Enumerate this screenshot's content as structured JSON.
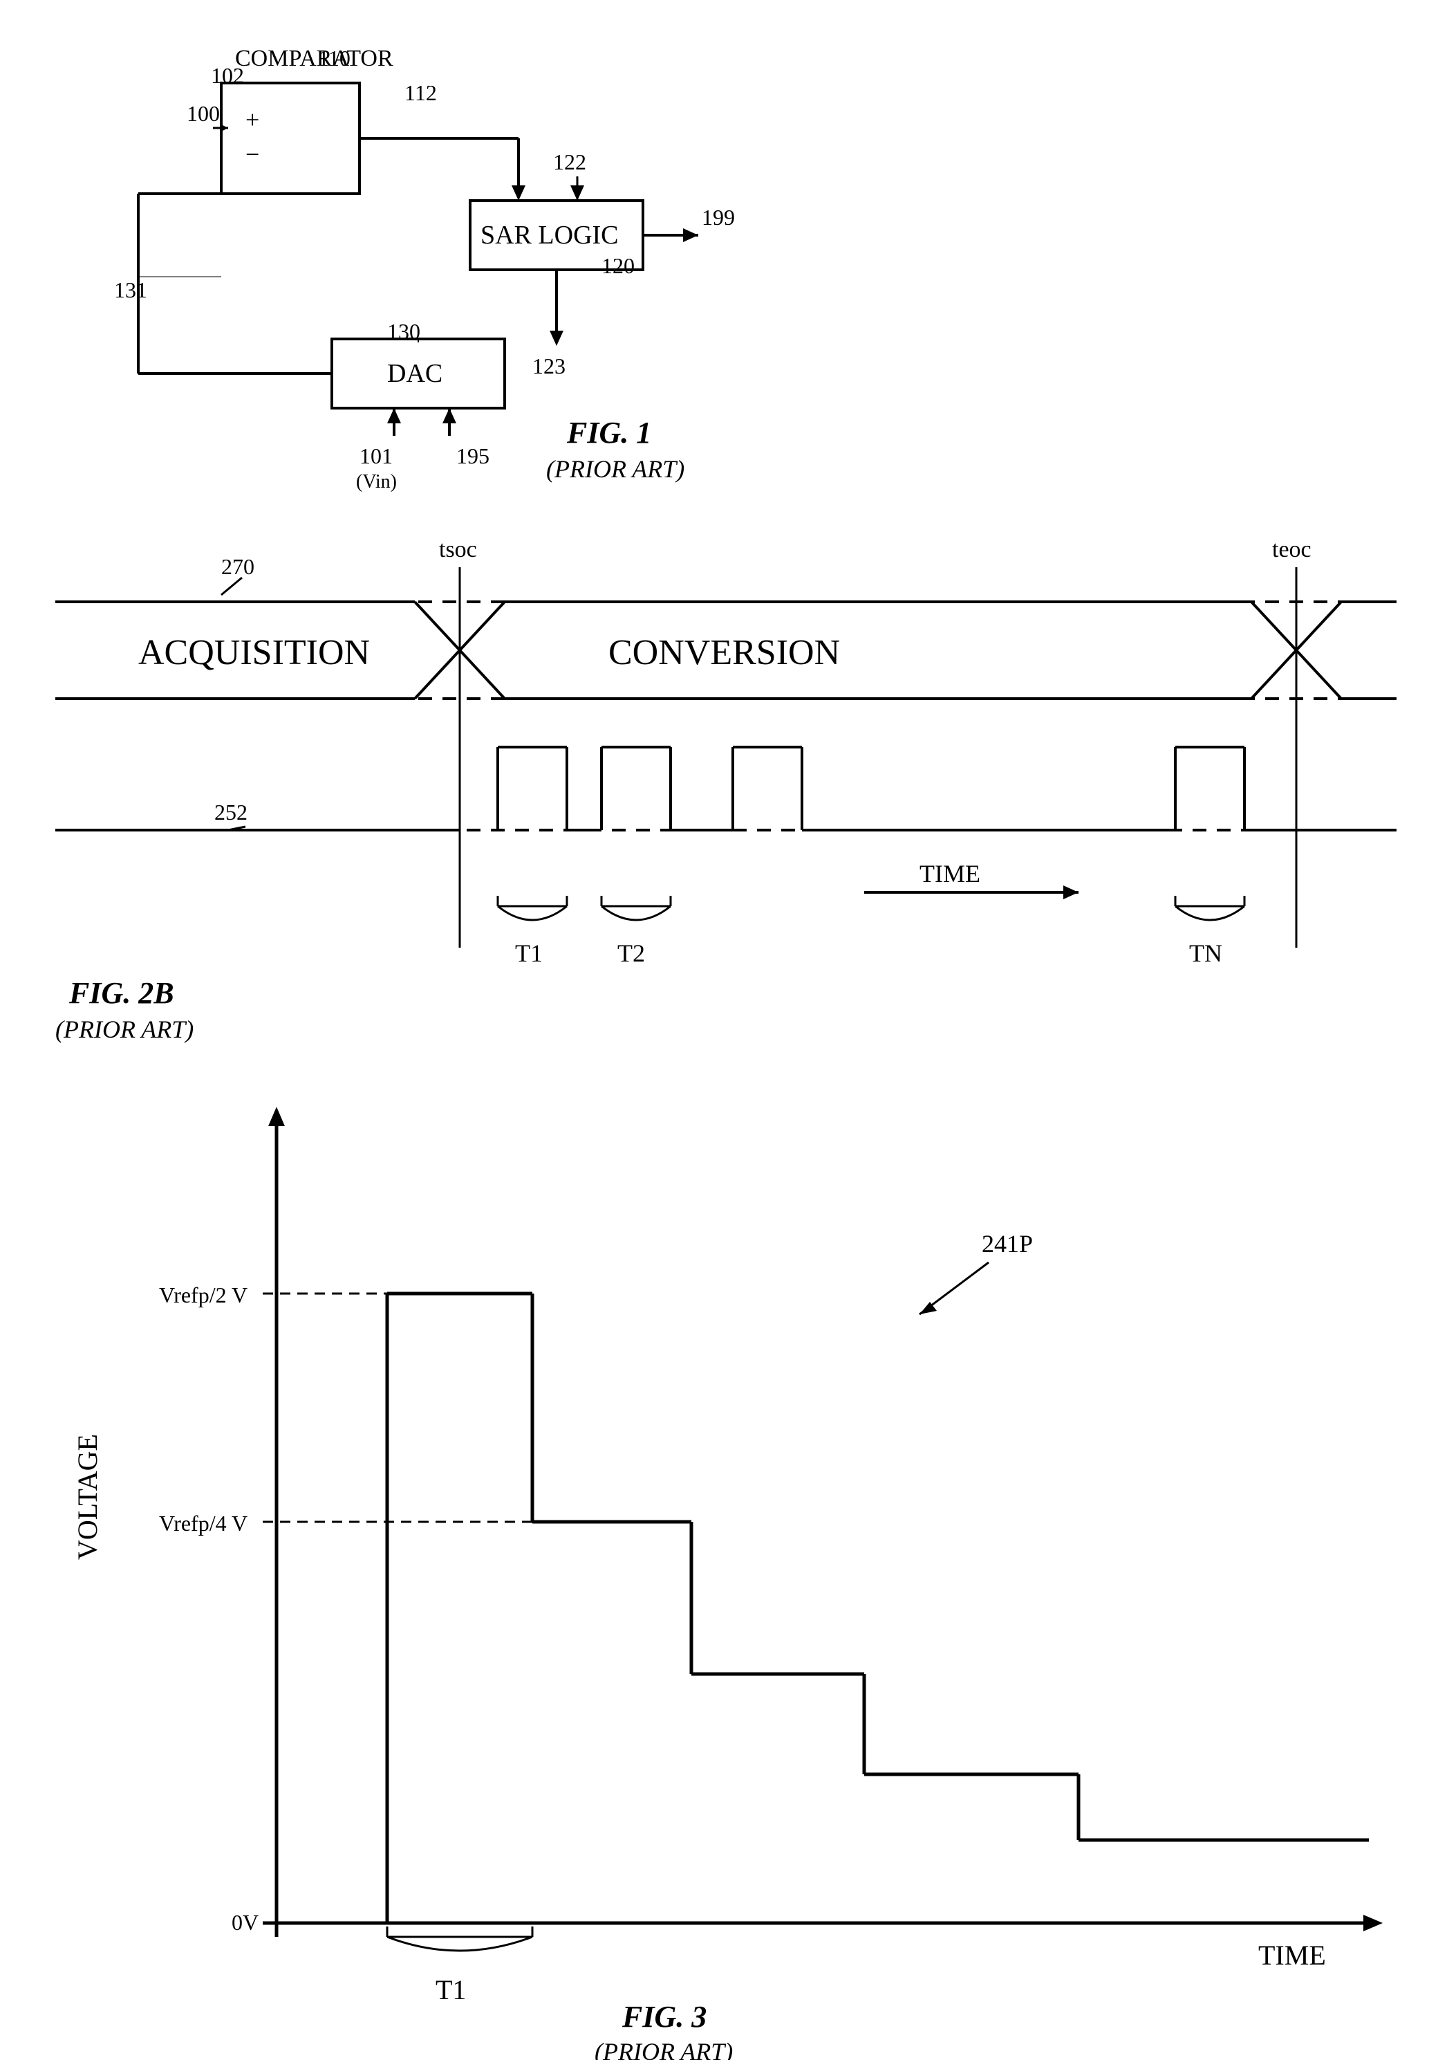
{
  "fig1": {
    "title": "FIG. 1",
    "subtitle": "(PRIOR ART)",
    "labels": {
      "comparator": "COMPARATOR",
      "sar_logic": "SAR LOGIC",
      "dac": "DAC",
      "n100": "100",
      "n101": "101",
      "n102": "102",
      "n110": "110",
      "n112": "112",
      "n120": "120",
      "n122": "122",
      "n123": "123",
      "n130": "130",
      "n131": "131",
      "n195": "195",
      "n199": "199",
      "vin": "(Vin)"
    }
  },
  "fig2b": {
    "title": "FIG. 2B",
    "subtitle": "(PRIOR ART)",
    "labels": {
      "acquisition": "ACQUISITION",
      "conversion": "CONVERSION",
      "n270": "270",
      "n252": "252",
      "tsoc": "tsoc",
      "teoc": "teoc",
      "t1": "T1",
      "t2": "T2",
      "tn": "TN",
      "time": "TIME"
    }
  },
  "fig3": {
    "title": "FIG. 3",
    "subtitle": "(PRIOR ART)",
    "labels": {
      "voltage": "VOLTAGE",
      "time": "TIME",
      "vrefp2": "Vrefp/2 V",
      "vrefp4": "Vrefp/4 V",
      "ov": "0V",
      "t1": "T1",
      "n241p": "241P"
    }
  }
}
